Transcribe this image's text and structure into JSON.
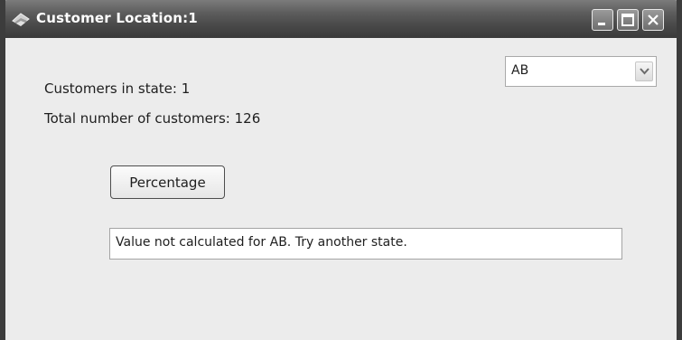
{
  "window": {
    "title": "Customer Location:1",
    "icon": "app-icon"
  },
  "titlebar_buttons": {
    "minimize_icon": "minimize-icon",
    "maximize_icon": "maximize-icon",
    "close_icon": "close-icon"
  },
  "labels": {
    "customers_in_state": "Customers in state: 1",
    "total_customers": "Total number of customers: 126"
  },
  "state_select": {
    "selected": "AB",
    "arrow_icon": "chevron-down-icon"
  },
  "percentage_button": {
    "label": "Percentage"
  },
  "result_field": {
    "value": "Value not calculated for AB. Try another state."
  },
  "colors": {
    "titlebar": "#474747",
    "window_background": "#ececec",
    "frame": "#3c3c3c"
  }
}
